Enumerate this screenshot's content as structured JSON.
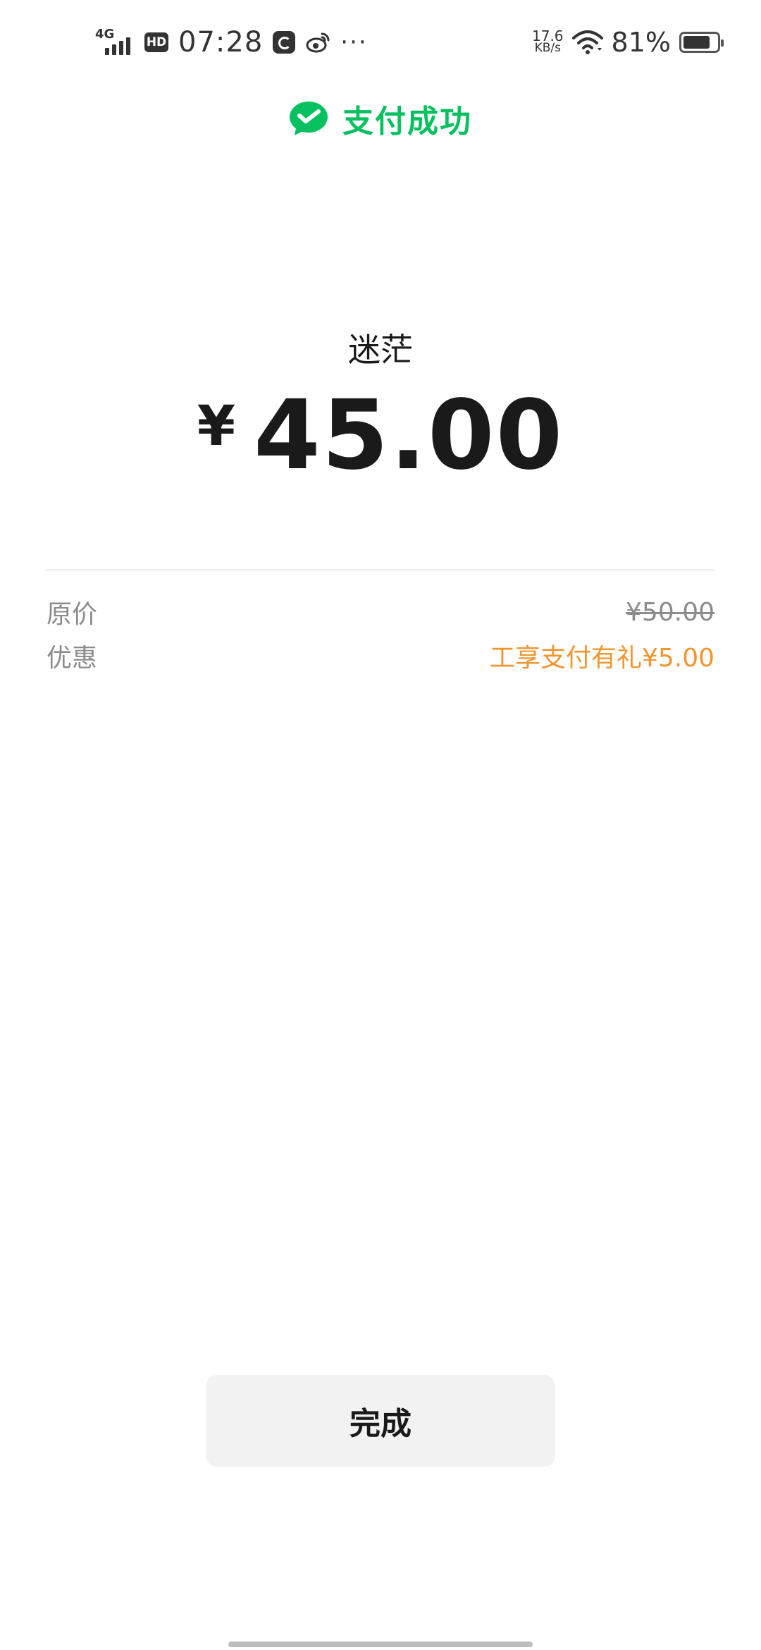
{
  "status_bar": {
    "network_type": "4G",
    "hd_label": "HD",
    "time": "07:28",
    "more": "···",
    "net_speed_value": "17.6",
    "net_speed_unit": "KB/s",
    "battery_percent": "81%",
    "battery_level": 0.81
  },
  "header": {
    "title": "支付成功",
    "icon": "wechat-pay-icon",
    "accent_color": "#07c160"
  },
  "payment": {
    "merchant": "迷茫",
    "currency_symbol": "¥",
    "amount": "45.00"
  },
  "details": {
    "original_label": "原价",
    "original_value": "¥50.00",
    "discount_label": "优惠",
    "discount_value": "工享支付有礼¥5.00",
    "discount_color": "#f2962f"
  },
  "actions": {
    "done_label": "完成"
  }
}
